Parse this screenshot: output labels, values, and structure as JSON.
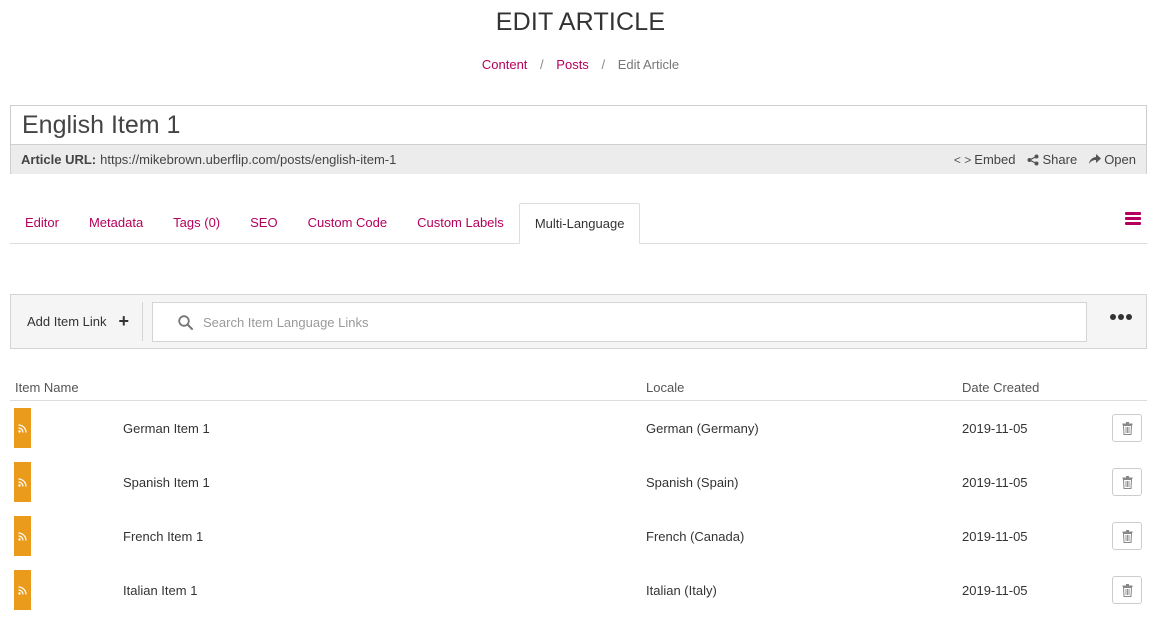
{
  "page": {
    "title": "EDIT ARTICLE"
  },
  "breadcrumb": {
    "items": [
      "Content",
      "Posts"
    ],
    "separator": "/",
    "current": "Edit Article"
  },
  "article": {
    "title_value": "English Item 1",
    "url_label": "Article URL:",
    "url_value": "https://mikebrown.uberflip.com/posts/english-item-1",
    "actions": [
      {
        "label": "Embed",
        "icon": "code-icon",
        "glyph": "< >"
      },
      {
        "label": "Share",
        "icon": "share-icon",
        "glyph": "⋖"
      },
      {
        "label": "Open",
        "icon": "open-arrow-icon",
        "glyph": "➦"
      }
    ]
  },
  "tabs": [
    {
      "label": "Editor",
      "active": false
    },
    {
      "label": "Metadata",
      "active": false
    },
    {
      "label": "Tags (0)",
      "active": false
    },
    {
      "label": "SEO",
      "active": false
    },
    {
      "label": "Custom Code",
      "active": false
    },
    {
      "label": "Custom Labels",
      "active": false
    },
    {
      "label": "Multi-Language",
      "active": true
    }
  ],
  "toolbar": {
    "add_label": "Add Item Link",
    "add_glyph": "+",
    "search_placeholder": "Search Item Language Links"
  },
  "table": {
    "columns": [
      "Item Name",
      "Locale",
      "Date Created"
    ],
    "rows": [
      {
        "name": "German Item 1",
        "locale": "German (Germany)",
        "date": "2019-11-05"
      },
      {
        "name": "Spanish Item 1",
        "locale": "Spanish (Spain)",
        "date": "2019-11-05"
      },
      {
        "name": "French Item 1",
        "locale": "French (Canada)",
        "date": "2019-11-05"
      },
      {
        "name": "Italian Item 1",
        "locale": "Italian (Italy)",
        "date": "2019-11-05"
      }
    ]
  },
  "colors": {
    "accent": "#b5005b",
    "thumbnail": "#ea9b1c"
  }
}
